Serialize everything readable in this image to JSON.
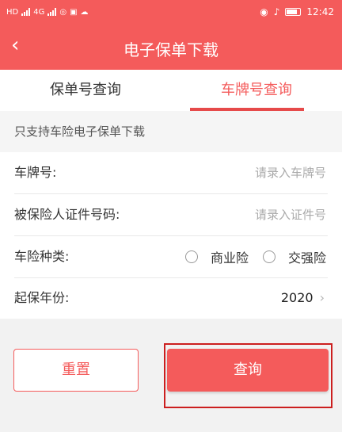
{
  "status_bar": {
    "left_text": "HD",
    "net_label": "4G",
    "time": "12:42"
  },
  "header": {
    "back_glyph": "‹",
    "title": "电子保单下载"
  },
  "tabs": [
    {
      "label": "保单号查询",
      "active": false
    },
    {
      "label": "车牌号查询",
      "active": true
    }
  ],
  "notice": "只支持车险电子保单下载",
  "form": {
    "plate": {
      "label": "车牌号:",
      "placeholder": "请录入车牌号",
      "value": ""
    },
    "id_number": {
      "label": "被保险人证件号码:",
      "placeholder": "请录入证件号",
      "value": ""
    },
    "insurance_type": {
      "label": "车险种类:",
      "options": [
        {
          "label": "商业险",
          "selected": false
        },
        {
          "label": "交强险",
          "selected": false
        }
      ]
    },
    "start_year": {
      "label": "起保年份:",
      "value": "2020"
    }
  },
  "buttons": {
    "reset": "重置",
    "query": "查询"
  },
  "colors": {
    "brand": "#f45b5b",
    "highlight_frame": "#cc1f1f"
  }
}
